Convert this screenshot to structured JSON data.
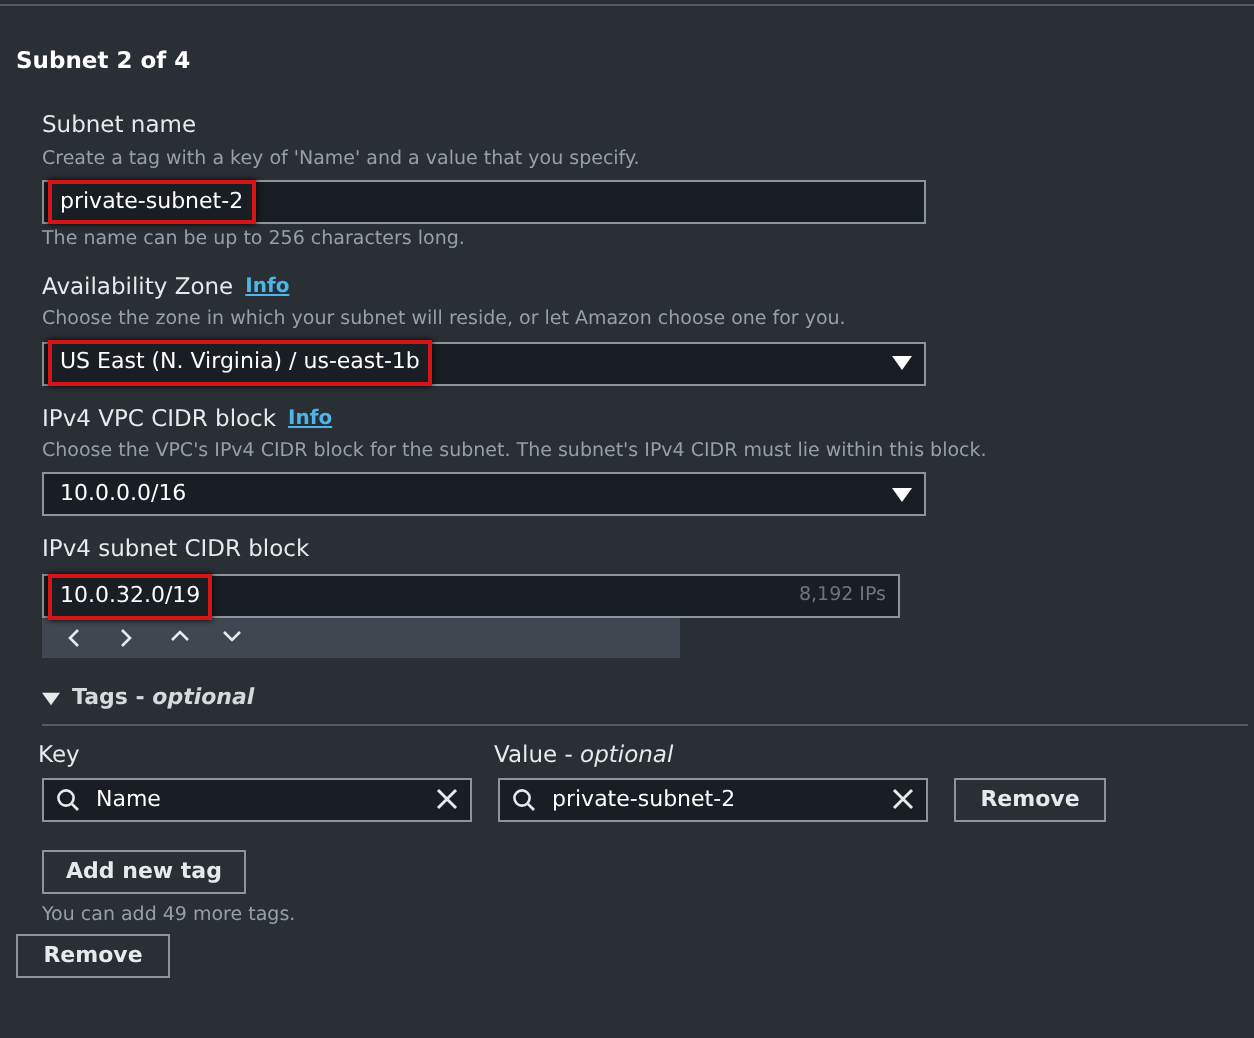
{
  "heading": "Subnet 2 of 4",
  "fields": [
    {
      "kind": "text",
      "label": "Subnet name",
      "description": "Create a tag with a key of 'Name' and a value that you specify.",
      "value": "private-subnet-2",
      "highlighted": true,
      "hint": "The name can be up to 256 characters long."
    },
    {
      "kind": "select",
      "label": "Availability Zone",
      "info": "Info",
      "description": "Choose the zone in which your subnet will reside, or let Amazon choose one for you.",
      "value": "US East (N. Virginia) / us-east-1b",
      "highlighted": true
    },
    {
      "kind": "select",
      "label": "IPv4 VPC CIDR block",
      "info": "Info",
      "description": "Choose the VPC's IPv4 CIDR block for the subnet. The subnet's IPv4 CIDR must lie within this block.",
      "value": "10.0.0.0/16",
      "highlighted": false
    },
    {
      "kind": "cidr",
      "label": "IPv4 subnet CIDR block",
      "value": "10.0.32.0/19",
      "highlighted": true,
      "suffix": "8,192 IPs"
    }
  ],
  "tags": {
    "title": "Tags - *optional*",
    "expanded": true,
    "key_label": "Key",
    "value_label": "Value - *optional*",
    "rows": [
      {
        "key": "Name",
        "value": "private-subnet-2",
        "remove": "Remove"
      }
    ],
    "add_button": "Add new tag",
    "note": "You can add 49 more tags."
  },
  "remove_button": "Remove"
}
